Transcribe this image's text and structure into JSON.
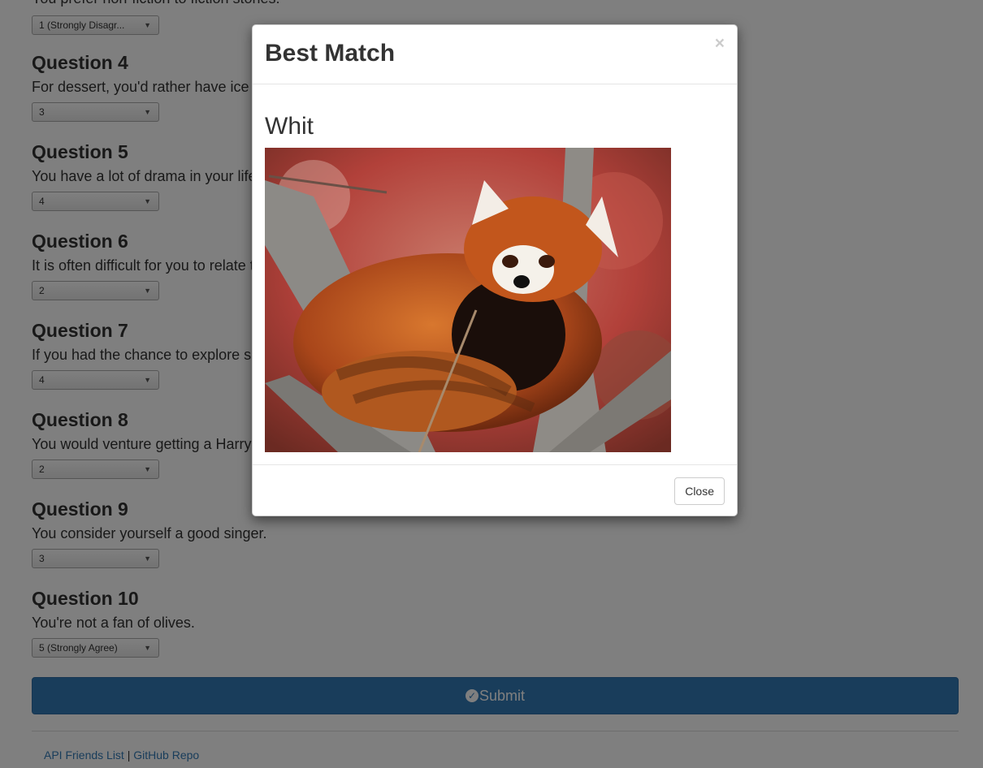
{
  "survey": {
    "partial_line": "You prefer non-fiction to fiction stories.",
    "partial_select": "1 (Strongly Disagr...",
    "questions": [
      {
        "title": "Question 4",
        "text": "For dessert, you'd rather have ice",
        "answer": "3"
      },
      {
        "title": "Question 5",
        "text": "You have a lot of drama in your life",
        "answer": "4"
      },
      {
        "title": "Question 6",
        "text": "It is often difficult for you to relate t",
        "answer": "2"
      },
      {
        "title": "Question 7",
        "text": "If you had the chance to explore s",
        "answer": "4"
      },
      {
        "title": "Question 8",
        "text": "You would venture getting a Harry",
        "answer": "2"
      },
      {
        "title": "Question 9",
        "text": "You consider yourself a good singer.",
        "answer": "3"
      },
      {
        "title": "Question 10",
        "text": "You're not a fan of olives.",
        "answer": "5 (Strongly Agree)"
      }
    ],
    "submit_label": "Submit"
  },
  "footer": {
    "link_api": "API Friends List",
    "separator": "|",
    "link_github": "GitHub Repo"
  },
  "modal": {
    "title": "Best Match",
    "close_x": "×",
    "match_name": "Whit",
    "photo_subject": "red panda",
    "close_label": "Close"
  },
  "colors": {
    "primary": "#337ab7",
    "backdrop": "rgba(0,0,0,0.5)"
  }
}
